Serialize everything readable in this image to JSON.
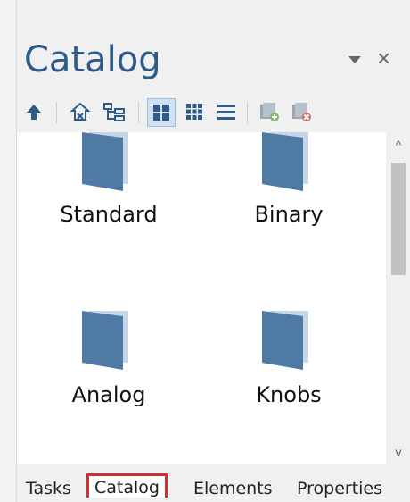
{
  "panel": {
    "title": "Catalog",
    "dropdown_icon": "caret-down-icon",
    "close_icon": "close-icon",
    "close_glyph": "×"
  },
  "toolbar": {
    "buttons": [
      {
        "name": "up-arrow-icon"
      },
      {
        "name": "home-icon"
      },
      {
        "name": "tree-view-icon"
      },
      {
        "name": "large-icons-view-icon",
        "active": true
      },
      {
        "name": "small-icons-view-icon"
      },
      {
        "name": "list-view-icon"
      },
      {
        "name": "add-element-icon"
      },
      {
        "name": "delete-element-icon"
      }
    ]
  },
  "items": [
    {
      "label": "Standard"
    },
    {
      "label": "Binary"
    },
    {
      "label": "Analog"
    },
    {
      "label": "Knobs"
    }
  ],
  "tabs": [
    {
      "label": "Tasks"
    },
    {
      "label": "Catalog",
      "selected": true
    },
    {
      "label": "Elements"
    },
    {
      "label": "Properties"
    }
  ],
  "scrollbar": {
    "up_glyph": "^",
    "down_glyph": "v"
  },
  "colors": {
    "title": "#2f5b8a",
    "folder": "#4f7aa3",
    "folder_back": "#c7d6e6",
    "selected_tab_outline": "#d32f2f"
  }
}
